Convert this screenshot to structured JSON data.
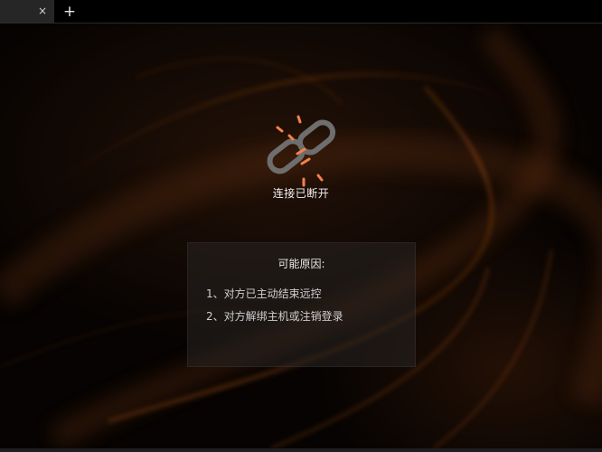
{
  "tabbar": {
    "close_glyph": "×",
    "add_glyph": "+"
  },
  "status": {
    "message": "连接已断开",
    "icon": "broken-link-icon"
  },
  "reasons": {
    "title": "可能原因:",
    "items": [
      "1、对方已主动结束远控",
      "2、对方解绑主机或注销登录"
    ]
  },
  "colors": {
    "accent": "#f5814a",
    "link_gray": "#6e6e6e",
    "background": "#060302"
  }
}
